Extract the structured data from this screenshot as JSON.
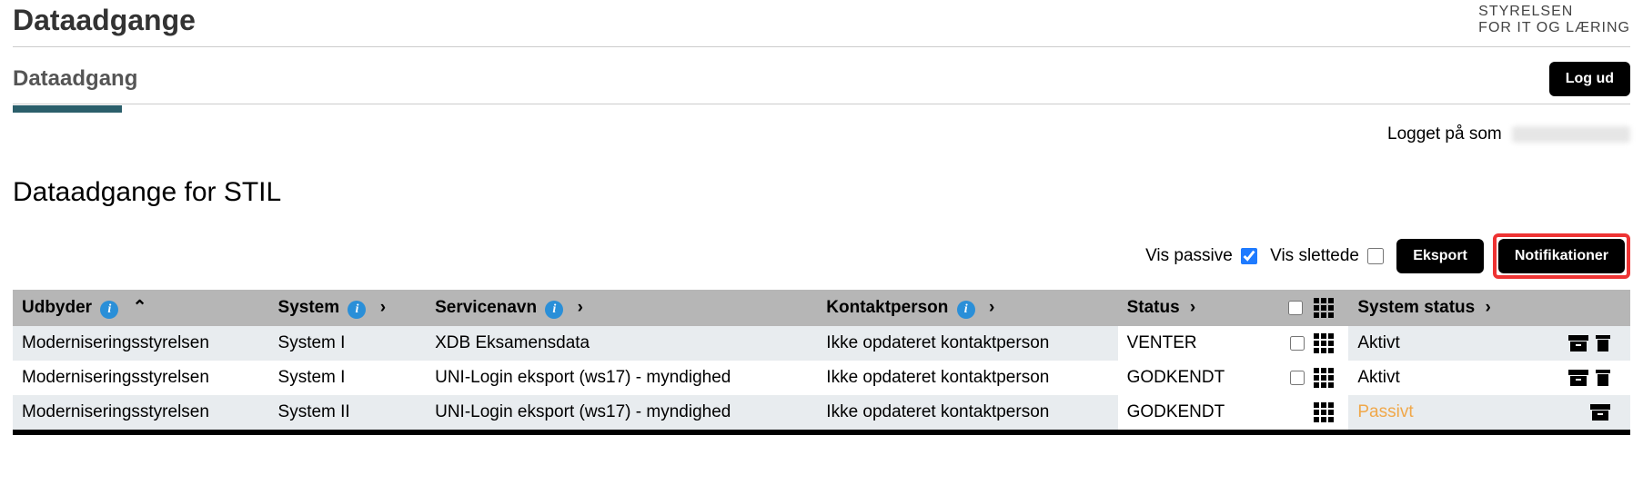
{
  "header": {
    "title": "Dataadgange",
    "logo_line1": "STYRELSEN",
    "logo_line2": "FOR IT OG LÆRING"
  },
  "subheader": {
    "tab_label": "Dataadgang",
    "logout_label": "Log ud"
  },
  "user": {
    "prefix": "Logget på som"
  },
  "section": {
    "title": "Dataadgange for STIL"
  },
  "controls": {
    "vis_passive": "Vis passive",
    "vis_passive_checked": true,
    "vis_slettede": "Vis slettede",
    "vis_slettede_checked": false,
    "eksport": "Eksport",
    "notifikationer": "Notifikationer"
  },
  "columns": {
    "udbyder": "Udbyder",
    "system": "System",
    "servicenavn": "Servicenavn",
    "kontaktperson": "Kontaktperson",
    "status": "Status",
    "system_status": "System status"
  },
  "rows": [
    {
      "udbyder": "Moderniseringsstyrelsen",
      "system": "System I",
      "servicenavn": "XDB Eksamensdata",
      "kontaktperson": "Ikke opdateret kontaktperson",
      "status": "VENTER",
      "has_checkbox": true,
      "system_status": "Aktivt",
      "passive": false,
      "has_trash": true
    },
    {
      "udbyder": "Moderniseringsstyrelsen",
      "system": "System I",
      "servicenavn": "UNI-Login eksport (ws17) - myndighed",
      "kontaktperson": "Ikke opdateret kontaktperson",
      "status": "GODKENDT",
      "has_checkbox": true,
      "system_status": "Aktivt",
      "passive": false,
      "has_trash": true
    },
    {
      "udbyder": "Moderniseringsstyrelsen",
      "system": "System II",
      "servicenavn": "UNI-Login eksport (ws17) - myndighed",
      "kontaktperson": "Ikke opdateret kontaktperson",
      "status": "GODKENDT",
      "has_checkbox": false,
      "system_status": "Passivt",
      "passive": true,
      "has_trash": false
    }
  ]
}
